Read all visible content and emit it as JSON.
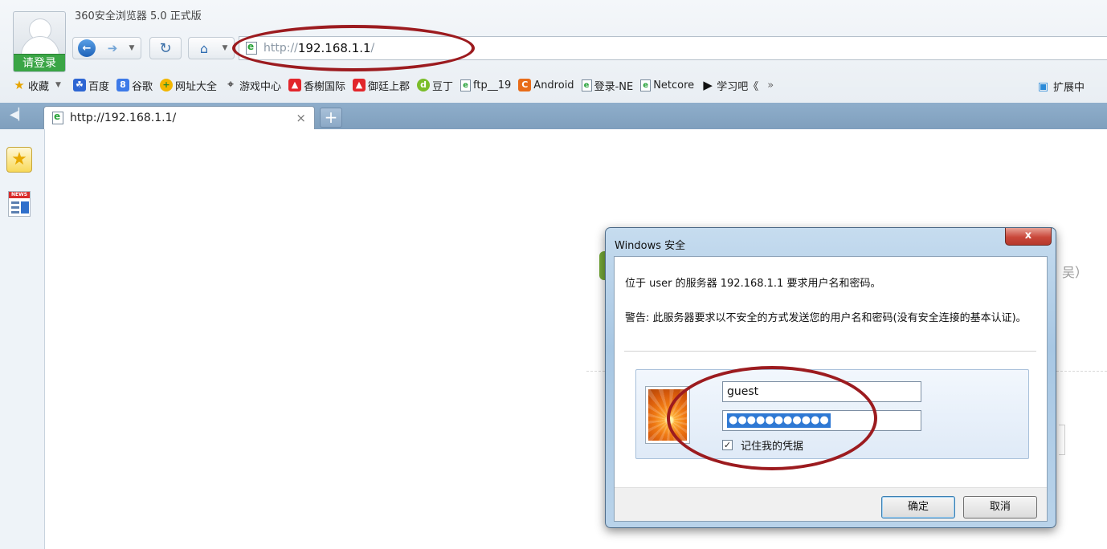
{
  "app": {
    "title": "360安全浏览器 5.0 正式版"
  },
  "user": {
    "login_label": "请登录"
  },
  "nav": {
    "back_icon": "back-arrow-icon",
    "forward_icon": "forward-arrow-icon",
    "refresh_icon": "refresh-icon",
    "home_icon": "home-icon"
  },
  "address": {
    "scheme": "http://",
    "host": "192.168.1.1",
    "path": "/"
  },
  "bookmarks": {
    "favorites": "收藏",
    "items": [
      "百度",
      "谷歌",
      "网址大全",
      "游戏中心",
      "香榭国际",
      "御廷上郡",
      "豆丁",
      "ftp__19",
      "Android",
      "登录-NE",
      "Netcore",
      "学习吧《"
    ],
    "more": "»",
    "extensions": "扩展中"
  },
  "tabs": [
    {
      "title": "http://192.168.1.1/",
      "close": "×"
    }
  ],
  "tab_new": "+",
  "sidebar": {
    "news_badge": "NEWS"
  },
  "background_page": {
    "paren": "吴）"
  },
  "dialog": {
    "title": "Windows 安全",
    "close": "x",
    "message": "位于 user 的服务器 192.168.1.1 要求用户名和密码。",
    "warning": "警告: 此服务器要求以不安全的方式发送您的用户名和密码(没有安全连接的基本认证)。",
    "username": "guest",
    "password_mask": "●●●●●●●●●●●",
    "remember_label": "记住我的凭据",
    "remember_checked": true,
    "ok_label": "确定",
    "cancel_label": "取消"
  },
  "colors": {
    "annotation": "#9c1b1f",
    "login_green": "#3aa545",
    "tabstrip": "#8faecb"
  }
}
